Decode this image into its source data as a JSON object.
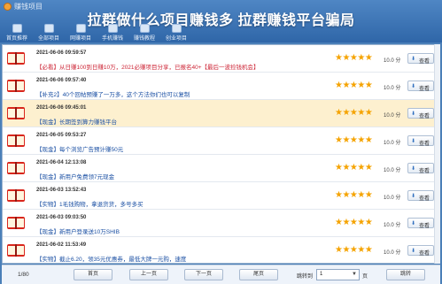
{
  "window": {
    "title": "赚钱项目"
  },
  "headline": "拉群做什么项目赚钱多 拉群赚钱平台骗局",
  "toolbar": [
    {
      "label": "首页推荐"
    },
    {
      "label": "全部项目"
    },
    {
      "label": "网赚项目"
    },
    {
      "label": "手机赚钱"
    },
    {
      "label": "赚钱教程"
    },
    {
      "label": "创业项目"
    }
  ],
  "list": [
    {
      "date": "2021-06-06 09:59:57",
      "desc": "【必看】从日赚100到日赚10万，2021必赚项目分享，已报名40+【最后一波捡钱机会】",
      "desc_color": "red",
      "stars": "★★★★★",
      "score": "10.0 分",
      "download": "查看"
    },
    {
      "date": "2021-06-06 09:57:40",
      "desc": "【补充2】40个回帖预赚了一万多，这个方法你们也可以复制",
      "desc_color": "blue",
      "stars": "★★★★★",
      "score": "10.0 分",
      "download": "查看"
    },
    {
      "date": "2021-06-06 09:45:01",
      "desc": "【现金】长期签到算力赚钱平台",
      "desc_color": "blue",
      "stars": "★★★★★",
      "score": "10.0 分",
      "download": "查看",
      "selected": true
    },
    {
      "date": "2021-06-05 09:53:27",
      "desc": "【现金】每个浏览广告预计赚50元",
      "desc_color": "blue",
      "stars": "★★★★★",
      "score": "10.0 分",
      "download": "查看"
    },
    {
      "date": "2021-06-04 12:13:08",
      "desc": "【现金】新用户免费领7元现金",
      "desc_color": "blue",
      "stars": "★★★★★",
      "score": "10.0 分",
      "download": "查看"
    },
    {
      "date": "2021-06-03 13:52:43",
      "desc": "【实物】1毛钱购物，拿退货货，多号多买",
      "desc_color": "blue",
      "stars": "★★★★★",
      "score": "10.0 分",
      "download": "查看"
    },
    {
      "date": "2021-06-03 09:03:50",
      "desc": "【现金】新用户登录送10万SHIB",
      "desc_color": "blue",
      "stars": "★★★★★",
      "score": "10.0 分",
      "download": "查看"
    },
    {
      "date": "2021-06-02 11:53:49",
      "desc": "【实物】截止6.20，领35元优惠券，最低大牌一元购，速度",
      "desc_color": "blue",
      "stars": "★★★★★",
      "score": "10.0 分",
      "download": "查看"
    }
  ],
  "pager": {
    "page_info": "1/80",
    "first": "首页",
    "prev": "上一页",
    "next": "下一页",
    "last": "尾页",
    "jump_label": "跳转到",
    "page_value": "1",
    "page_unit": "页",
    "jump_button": "跳转"
  },
  "colors": {
    "accent": "#2f66a8",
    "star": "#f5a300",
    "red_text": "#cc2233",
    "blue_text": "#1a4fa3"
  }
}
